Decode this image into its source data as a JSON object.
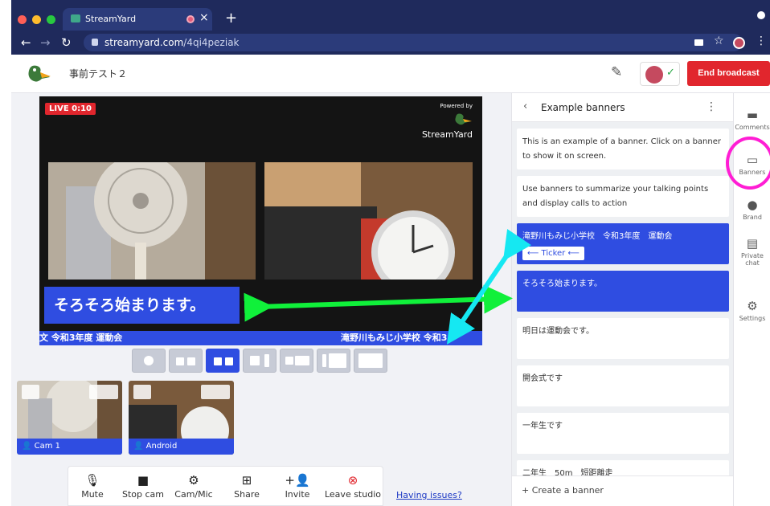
{
  "browser": {
    "tab_title": "StreamYard",
    "new_tab_glyph": "+",
    "close_glyph": "×",
    "url_host": "streamyard.com",
    "url_path": "/4qi4peziak"
  },
  "header": {
    "studio_title": "事前テスト２",
    "end_label": "End broadcast"
  },
  "stage": {
    "live_label": "LIVE 0:10",
    "powered_by": "Powered by",
    "brand": "StreamYard",
    "banner_text": "そろそろ始まります。",
    "ticker_text": "文 令和3年度 運動会 　　　　　　　　　　　　　　　　　　　　　　　　 滝野川もみじ小学校 令和3"
  },
  "cams": [
    {
      "label": "Cam 1"
    },
    {
      "label": "Android"
    }
  ],
  "toolbar": {
    "items": [
      {
        "label": "Mute",
        "icon": "mic-icon"
      },
      {
        "label": "Stop cam",
        "icon": "camera-icon"
      },
      {
        "label": "Cam/Mic",
        "icon": "gear-icon"
      },
      {
        "label": "Share",
        "icon": "screen-share-icon"
      },
      {
        "label": "Invite",
        "icon": "add-person-icon"
      },
      {
        "label": "Leave studio",
        "icon": "close-circle-icon"
      }
    ],
    "help_link": "Having issues?"
  },
  "panel": {
    "title": "Example banners",
    "create_label": "+ Create a banner",
    "ticker_chip": "⟵ Ticker ⟵",
    "banners": [
      {
        "text": "This is an example of a banner. Click on a banner to show it on screen.",
        "state": "normal"
      },
      {
        "text": "Use banners to summarize your talking points and display calls to action",
        "state": "normal"
      },
      {
        "text": "滝野川もみじ小学校　令和3年度　運動会",
        "state": "ticker"
      },
      {
        "text": "そろそろ始まります。",
        "state": "active"
      },
      {
        "text": "明日は運動会です。",
        "state": "normal"
      },
      {
        "text": "開会式です",
        "state": "normal"
      },
      {
        "text": "一年生です",
        "state": "normal"
      },
      {
        "text": "二年生　50m　短距離走",
        "state": "normal"
      }
    ]
  },
  "sidebar": {
    "items": [
      {
        "label": "Comments",
        "icon": "comment-icon"
      },
      {
        "label": "Banners",
        "icon": "banner-icon"
      },
      {
        "label": "Brand",
        "icon": "palette-icon"
      },
      {
        "label": "Private chat",
        "icon": "chat-icon"
      },
      {
        "label": "Settings",
        "icon": "gear-icon"
      }
    ]
  },
  "colors": {
    "accent": "#2f4de1",
    "end_red": "#e1262d",
    "highlight_ring": "#ff1dd4",
    "arrow_cyan": "#15e8f2",
    "arrow_green": "#10f03a"
  }
}
